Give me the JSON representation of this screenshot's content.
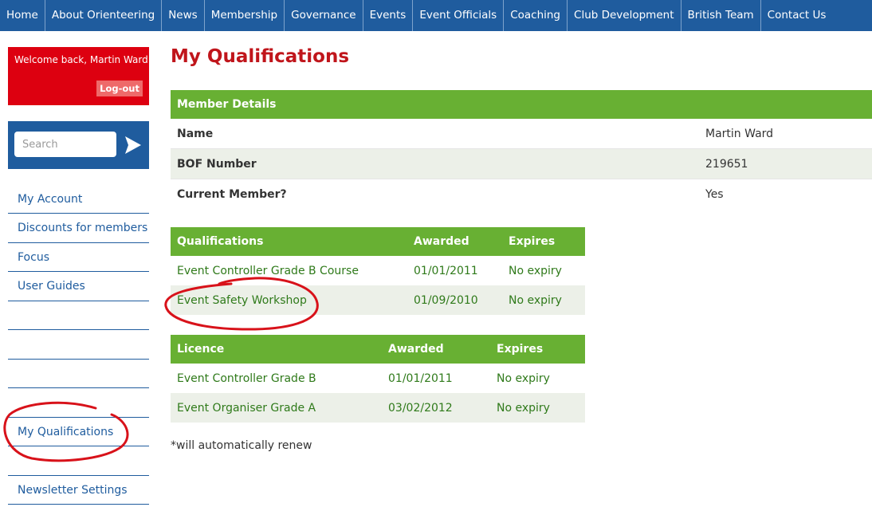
{
  "topnav": {
    "items": [
      "Home",
      "About Orienteering",
      "News",
      "Membership",
      "Governance",
      "Events",
      "Event Officials",
      "Coaching",
      "Club Development",
      "British Team",
      "Contact Us"
    ]
  },
  "welcome": {
    "message": "Welcome back, Martin Ward",
    "logout_label": "Log-out"
  },
  "search": {
    "placeholder": "Search",
    "icon": "arrow-right-icon"
  },
  "sidebar": {
    "items": [
      "My Account",
      "Discounts for members",
      "Focus",
      "User Guides",
      "",
      "",
      "",
      "",
      "My Qualifications",
      "",
      "Newsletter Settings"
    ]
  },
  "page": {
    "title": "My Qualifications"
  },
  "member_details": {
    "header": "Member Details",
    "rows": [
      {
        "label": "Name",
        "value": "Martin Ward"
      },
      {
        "label": "BOF Number",
        "value": "219651"
      },
      {
        "label": "Current Member?",
        "value": "Yes"
      }
    ]
  },
  "qualifications": {
    "headers": [
      "Qualifications",
      "Awarded",
      "Expires"
    ],
    "rows": [
      {
        "name": "Event Controller Grade B Course",
        "awarded": "01/01/2011",
        "expires": "No expiry"
      },
      {
        "name": "Event Safety Workshop",
        "awarded": "01/09/2010",
        "expires": "No expiry"
      }
    ]
  },
  "licence": {
    "headers": [
      "Licence",
      "Awarded",
      "Expires"
    ],
    "rows": [
      {
        "name": "Event Controller Grade B",
        "awarded": "01/01/2011",
        "expires": "No expiry"
      },
      {
        "name": "Event Organiser Grade A",
        "awarded": "03/02/2012",
        "expires": "No expiry"
      }
    ]
  },
  "footnote": "*will automatically renew",
  "colors": {
    "nav_blue": "#1f5c9e",
    "header_green": "#68b033",
    "title_red": "#c0151b",
    "welcome_red": "#dd0010",
    "annotation_red": "#d8121a"
  }
}
